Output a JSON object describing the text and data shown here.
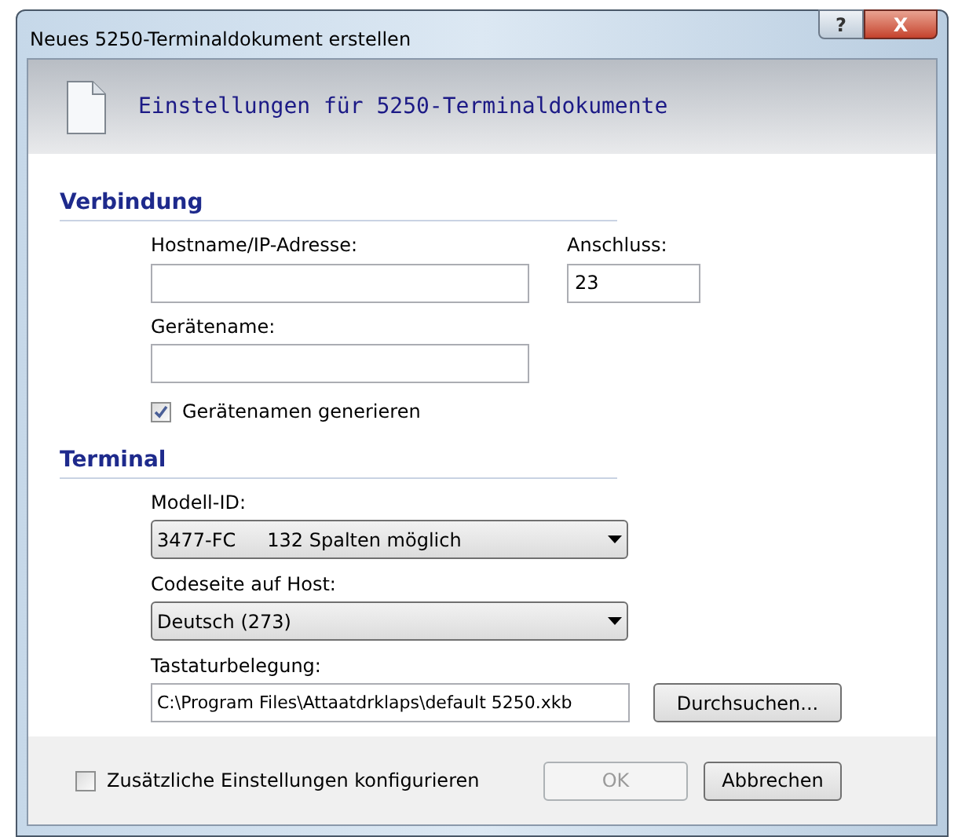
{
  "window": {
    "title": "Neues 5250-Terminaldokument erstellen",
    "help_button": "?",
    "close_button": "X"
  },
  "header": {
    "title": "Einstellungen für 5250-Terminaldokumente"
  },
  "connection": {
    "heading": "Verbindung",
    "hostname": {
      "label": "Hostname/IP-Adresse:"
    },
    "port": {
      "label": "Anschluss:",
      "value": "23"
    },
    "device_name": {
      "label": "Gerätename:"
    },
    "generate": {
      "label": "Gerätenamen generieren",
      "checked": true
    }
  },
  "terminal": {
    "heading": "Terminal",
    "model": {
      "label": "Modell-ID:",
      "value": "3477-FC",
      "note": "132 Spalten möglich"
    },
    "codepage": {
      "label": "Codeseite auf Host:",
      "value": "Deutsch (273)"
    },
    "keyboard": {
      "label": "Tastaturbelegung:",
      "value": "C:\\Program Files\\Attaatdrklaps\\default 5250.xkb",
      "browse": "Durchsuchen..."
    }
  },
  "footer": {
    "extra": {
      "label": "Zusätzliche Einstellungen konfigurieren",
      "checked": false
    },
    "buttons": [
      {
        "label": "OK",
        "disabled": true
      },
      {
        "label": "Abbrechen",
        "disabled": false
      }
    ]
  }
}
